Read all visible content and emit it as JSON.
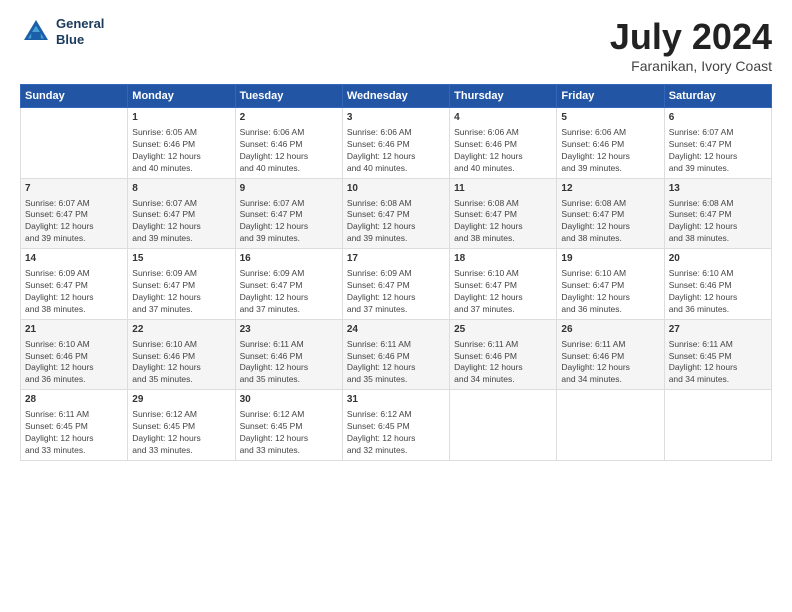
{
  "logo": {
    "line1": "General",
    "line2": "Blue"
  },
  "title": "July 2024",
  "subtitle": "Faranikan, Ivory Coast",
  "columns": [
    "Sunday",
    "Monday",
    "Tuesday",
    "Wednesday",
    "Thursday",
    "Friday",
    "Saturday"
  ],
  "weeks": [
    [
      {
        "day": "",
        "content": ""
      },
      {
        "day": "1",
        "content": "Sunrise: 6:05 AM\nSunset: 6:46 PM\nDaylight: 12 hours\nand 40 minutes."
      },
      {
        "day": "2",
        "content": "Sunrise: 6:06 AM\nSunset: 6:46 PM\nDaylight: 12 hours\nand 40 minutes."
      },
      {
        "day": "3",
        "content": "Sunrise: 6:06 AM\nSunset: 6:46 PM\nDaylight: 12 hours\nand 40 minutes."
      },
      {
        "day": "4",
        "content": "Sunrise: 6:06 AM\nSunset: 6:46 PM\nDaylight: 12 hours\nand 40 minutes."
      },
      {
        "day": "5",
        "content": "Sunrise: 6:06 AM\nSunset: 6:46 PM\nDaylight: 12 hours\nand 39 minutes."
      },
      {
        "day": "6",
        "content": "Sunrise: 6:07 AM\nSunset: 6:47 PM\nDaylight: 12 hours\nand 39 minutes."
      }
    ],
    [
      {
        "day": "7",
        "content": "Sunrise: 6:07 AM\nSunset: 6:47 PM\nDaylight: 12 hours\nand 39 minutes."
      },
      {
        "day": "8",
        "content": "Sunrise: 6:07 AM\nSunset: 6:47 PM\nDaylight: 12 hours\nand 39 minutes."
      },
      {
        "day": "9",
        "content": "Sunrise: 6:07 AM\nSunset: 6:47 PM\nDaylight: 12 hours\nand 39 minutes."
      },
      {
        "day": "10",
        "content": "Sunrise: 6:08 AM\nSunset: 6:47 PM\nDaylight: 12 hours\nand 39 minutes."
      },
      {
        "day": "11",
        "content": "Sunrise: 6:08 AM\nSunset: 6:47 PM\nDaylight: 12 hours\nand 38 minutes."
      },
      {
        "day": "12",
        "content": "Sunrise: 6:08 AM\nSunset: 6:47 PM\nDaylight: 12 hours\nand 38 minutes."
      },
      {
        "day": "13",
        "content": "Sunrise: 6:08 AM\nSunset: 6:47 PM\nDaylight: 12 hours\nand 38 minutes."
      }
    ],
    [
      {
        "day": "14",
        "content": "Sunrise: 6:09 AM\nSunset: 6:47 PM\nDaylight: 12 hours\nand 38 minutes."
      },
      {
        "day": "15",
        "content": "Sunrise: 6:09 AM\nSunset: 6:47 PM\nDaylight: 12 hours\nand 37 minutes."
      },
      {
        "day": "16",
        "content": "Sunrise: 6:09 AM\nSunset: 6:47 PM\nDaylight: 12 hours\nand 37 minutes."
      },
      {
        "day": "17",
        "content": "Sunrise: 6:09 AM\nSunset: 6:47 PM\nDaylight: 12 hours\nand 37 minutes."
      },
      {
        "day": "18",
        "content": "Sunrise: 6:10 AM\nSunset: 6:47 PM\nDaylight: 12 hours\nand 37 minutes."
      },
      {
        "day": "19",
        "content": "Sunrise: 6:10 AM\nSunset: 6:47 PM\nDaylight: 12 hours\nand 36 minutes."
      },
      {
        "day": "20",
        "content": "Sunrise: 6:10 AM\nSunset: 6:46 PM\nDaylight: 12 hours\nand 36 minutes."
      }
    ],
    [
      {
        "day": "21",
        "content": "Sunrise: 6:10 AM\nSunset: 6:46 PM\nDaylight: 12 hours\nand 36 minutes."
      },
      {
        "day": "22",
        "content": "Sunrise: 6:10 AM\nSunset: 6:46 PM\nDaylight: 12 hours\nand 35 minutes."
      },
      {
        "day": "23",
        "content": "Sunrise: 6:11 AM\nSunset: 6:46 PM\nDaylight: 12 hours\nand 35 minutes."
      },
      {
        "day": "24",
        "content": "Sunrise: 6:11 AM\nSunset: 6:46 PM\nDaylight: 12 hours\nand 35 minutes."
      },
      {
        "day": "25",
        "content": "Sunrise: 6:11 AM\nSunset: 6:46 PM\nDaylight: 12 hours\nand 34 minutes."
      },
      {
        "day": "26",
        "content": "Sunrise: 6:11 AM\nSunset: 6:46 PM\nDaylight: 12 hours\nand 34 minutes."
      },
      {
        "day": "27",
        "content": "Sunrise: 6:11 AM\nSunset: 6:45 PM\nDaylight: 12 hours\nand 34 minutes."
      }
    ],
    [
      {
        "day": "28",
        "content": "Sunrise: 6:11 AM\nSunset: 6:45 PM\nDaylight: 12 hours\nand 33 minutes."
      },
      {
        "day": "29",
        "content": "Sunrise: 6:12 AM\nSunset: 6:45 PM\nDaylight: 12 hours\nand 33 minutes."
      },
      {
        "day": "30",
        "content": "Sunrise: 6:12 AM\nSunset: 6:45 PM\nDaylight: 12 hours\nand 33 minutes."
      },
      {
        "day": "31",
        "content": "Sunrise: 6:12 AM\nSunset: 6:45 PM\nDaylight: 12 hours\nand 32 minutes."
      },
      {
        "day": "",
        "content": ""
      },
      {
        "day": "",
        "content": ""
      },
      {
        "day": "",
        "content": ""
      }
    ]
  ]
}
